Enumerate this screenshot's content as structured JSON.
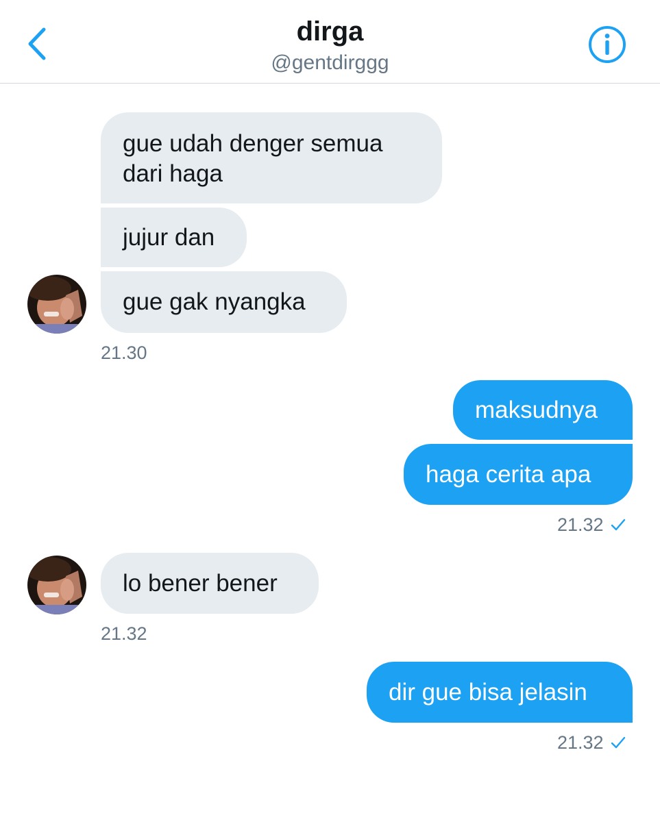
{
  "header": {
    "title": "dirga",
    "handle": "@gentdirggg",
    "back_icon": "chevron-left-icon",
    "info_icon": "info-icon",
    "accent_color": "#1da1f2"
  },
  "messages": [
    {
      "direction": "incoming",
      "lines": [
        "gue udah denger semua",
        "dari haga"
      ]
    },
    {
      "direction": "incoming",
      "text": "jujur dan"
    },
    {
      "direction": "incoming",
      "text": "gue gak nyangka"
    },
    {
      "direction": "outgoing",
      "text": "maksudnya"
    },
    {
      "direction": "outgoing",
      "text": "haga cerita apa"
    },
    {
      "direction": "incoming",
      "text": "lo bener bener"
    },
    {
      "direction": "outgoing",
      "text": "dir gue bisa jelasin"
    }
  ],
  "timestamps": {
    "group1": "21.30",
    "group2": "21.32",
    "group3": "21.32",
    "group4": "21.32"
  },
  "colors": {
    "incoming_bubble": "#e6ecf0",
    "outgoing_bubble": "#1da1f2",
    "timestamp_text": "#657786",
    "read_check": "#1da1f2"
  }
}
